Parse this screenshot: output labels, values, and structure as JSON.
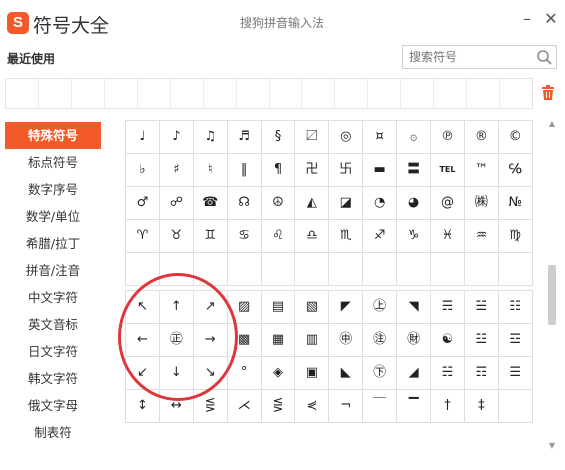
{
  "titlebar": {
    "logo_letter": "S",
    "title": "符号大全",
    "ime_name": "搜狗拼音输入法",
    "minimize_glyph": "–",
    "close_glyph": "✕"
  },
  "recent": {
    "label": "最近使用",
    "search_placeholder": "搜索符号"
  },
  "sidebar": {
    "items": [
      {
        "label": "特殊符号",
        "active": true
      },
      {
        "label": "标点符号"
      },
      {
        "label": "数字序号"
      },
      {
        "label": "数学/单位"
      },
      {
        "label": "希腊/拉丁"
      },
      {
        "label": "拼音/注音"
      },
      {
        "label": "中文字符"
      },
      {
        "label": "英文音标"
      },
      {
        "label": "日文字符"
      },
      {
        "label": "韩文字符"
      },
      {
        "label": "俄文字母"
      },
      {
        "label": "制表符"
      }
    ]
  },
  "grid1": {
    "rows": [
      [
        "♩",
        "♪",
        "♫",
        "♬",
        "§",
        "〼",
        "◎",
        "¤",
        "۞",
        "℗",
        "®",
        "©"
      ],
      [
        "♭",
        "♯",
        "♮",
        "‖",
        "¶",
        "卍",
        "卐",
        "▬",
        "〓",
        "TEL",
        "™",
        "℅"
      ],
      [
        "♂",
        "☍",
        "☎",
        "☊",
        "☮",
        "◭",
        "◪",
        "◔",
        "◕",
        "@",
        "㈱",
        "№"
      ],
      [
        "♈",
        "♉",
        "♊",
        "♋",
        "♌",
        "♎",
        "♏",
        "♐",
        "♑",
        "♓",
        "♒",
        "♍"
      ],
      [
        "",
        "",
        "",
        "",
        "",
        "",
        "",
        "",
        "",
        "",
        "",
        ""
      ]
    ]
  },
  "grid2": {
    "rows": [
      [
        "↖",
        "↑",
        "↗",
        "▨",
        "▤",
        "▧",
        "◤",
        "㊤",
        "◥",
        "☴",
        "☱",
        "☷"
      ],
      [
        "←",
        "㊣",
        "→",
        "▩",
        "▦",
        "▥",
        "㊥",
        "㊟",
        "㊖",
        "☯",
        "☳",
        "☲"
      ],
      [
        "↙",
        "↓",
        "↘",
        "°",
        "◈",
        "▣",
        "◣",
        "㊦",
        "◢",
        "☵",
        "☶",
        "☰"
      ],
      [
        "↕",
        "↔",
        "⋚",
        "⋌",
        "⋚",
        "⋞",
        "¬",
        "￣",
        "▔",
        "†",
        "‡",
        ""
      ]
    ]
  }
}
